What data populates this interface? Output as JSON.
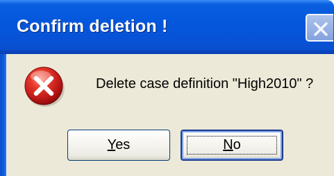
{
  "window": {
    "title": "Confirm deletion !"
  },
  "icons": {
    "close": "close-icon",
    "error": "error-icon"
  },
  "message": {
    "text": "Delete case definition \"High2010\" ?"
  },
  "buttons": {
    "yes": {
      "mnemonic": "Y",
      "rest": "es"
    },
    "no": {
      "mnemonic": "N",
      "rest": "o"
    }
  },
  "colors": {
    "titlebar": "#0457dc",
    "dialog_bg": "#ece9d8",
    "error_red": "#d21f1f"
  }
}
